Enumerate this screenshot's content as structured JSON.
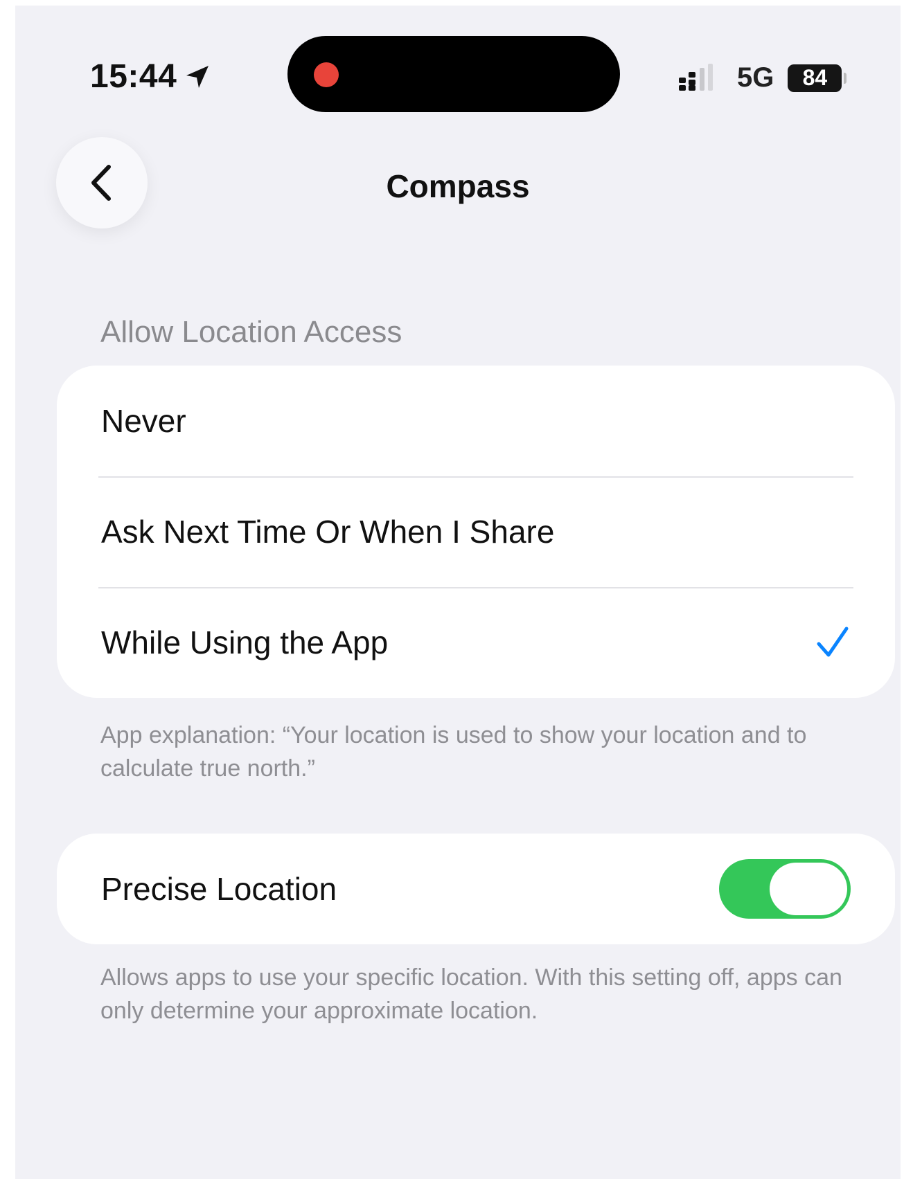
{
  "status_bar": {
    "time": "15:44",
    "network": "5G",
    "battery": "84"
  },
  "nav": {
    "title": "Compass"
  },
  "location_access": {
    "header": "Allow Location Access",
    "options": [
      {
        "label": "Never",
        "selected": false
      },
      {
        "label": "Ask Next Time Or When I Share",
        "selected": false
      },
      {
        "label": "While Using the App",
        "selected": true
      }
    ],
    "explanation": "App explanation: “Your location is used to show your location and to calculate true north.”"
  },
  "precise_location": {
    "label": "Precise Location",
    "enabled": true,
    "description": "Allows apps to use your specific location. With this setting off, apps can only determine your approximate location."
  },
  "colors": {
    "accent": "#0a84ff",
    "toggle_on": "#34c759",
    "recording": "#e8443a",
    "background": "#f1f1f6"
  }
}
